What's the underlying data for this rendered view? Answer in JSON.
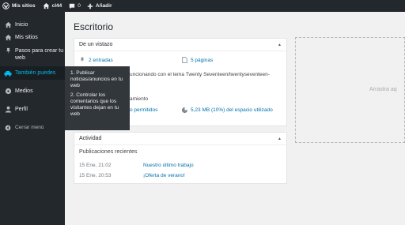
{
  "adminbar": {
    "wp_logo": "wordpress-icon",
    "my_sites": "Mis sitios",
    "site": "cl44",
    "comments": "0",
    "add_new": "Añadir"
  },
  "sidebar": {
    "items": [
      {
        "label": "Inicio",
        "icon": "dashboard-icon"
      },
      {
        "label": "Mis sitios",
        "icon": "sites-icon"
      },
      {
        "label": "Pasos para crear tu web",
        "icon": "pin-icon"
      },
      {
        "label": "También puedes",
        "icon": "car-icon"
      },
      {
        "label": "Medios",
        "icon": "media-icon"
      },
      {
        "label": "Perfil",
        "icon": "user-icon"
      }
    ],
    "collapse": "Cerrar menú"
  },
  "flyout": {
    "items": [
      "1. Publicar noticias/anuncios en tu web",
      "2. Controlar los comentarios que los visitantes dejan en tu web"
    ]
  },
  "main": {
    "title": "Escritorio",
    "glance": {
      "title": "De un vistazo",
      "posts": "2 entradas",
      "pages": "5 páginas",
      "theme_text": "uncionando con el tema Twenty Seventeen/twentyseventeen-",
      "storage_title": "amiento",
      "allowed": "o permitidos",
      "used": "5,23 MB (10%) del espacio utilizado"
    },
    "activity": {
      "title": "Actividad",
      "subtitle": "Publicaciones recientes",
      "rows": [
        {
          "date": "15 Ene, 21:02",
          "title": "Nuestro último trabajo"
        },
        {
          "date": "15 Ene, 20:53",
          "title": "¡Oferta de verano!"
        }
      ]
    },
    "drop_zone": "Arrastra aq"
  },
  "colors": {
    "accent": "#00b9eb",
    "link": "#0073aa",
    "adminbar": "#23282d"
  }
}
